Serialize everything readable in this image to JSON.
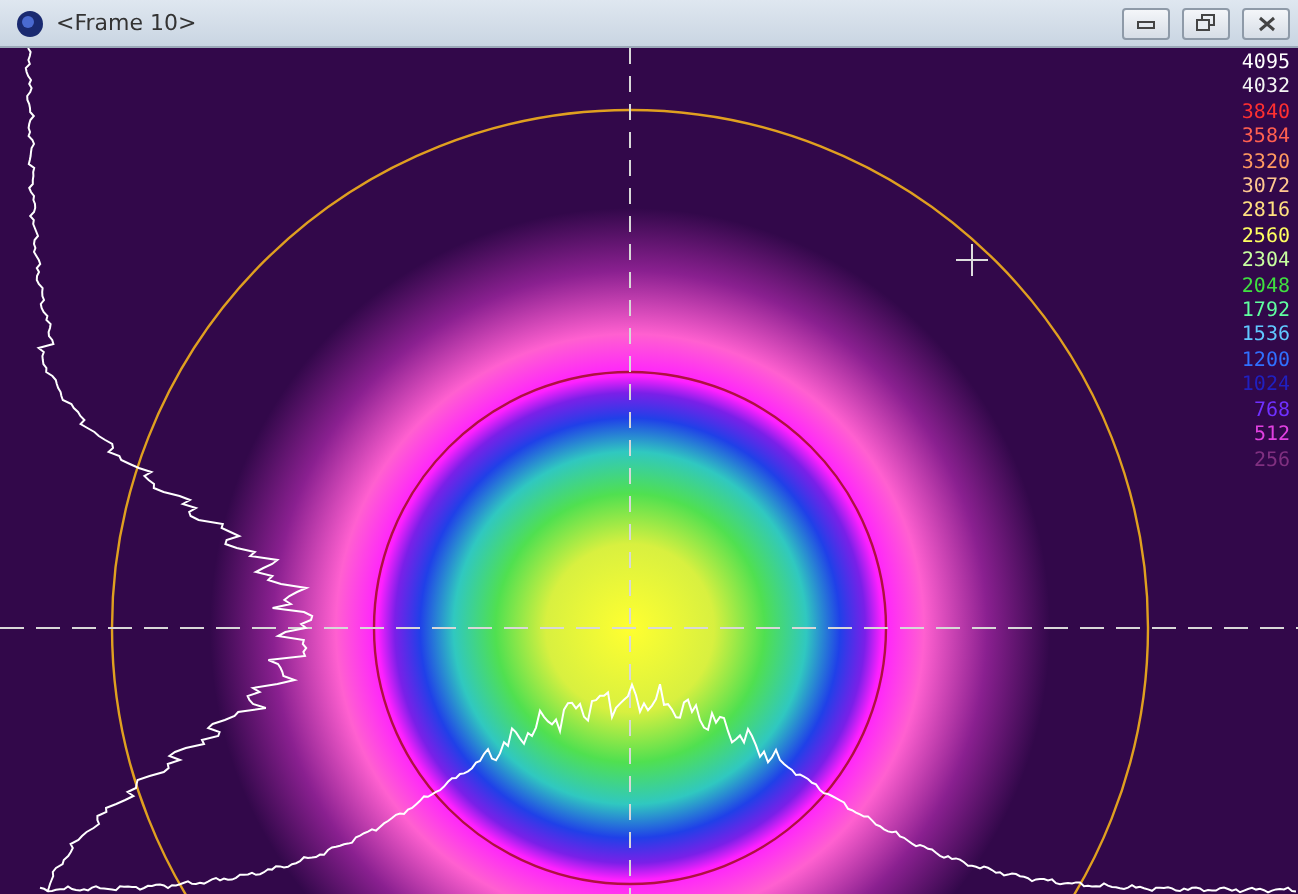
{
  "window": {
    "title": "<Frame 10>"
  },
  "legend": [
    {
      "label": "4095",
      "color": "#ffffff"
    },
    {
      "label": "4032",
      "color": "#f4f4f4"
    },
    {
      "label": "3840",
      "color": "#ff3030"
    },
    {
      "label": "3584",
      "color": "#ff6050"
    },
    {
      "label": "3320",
      "color": "#ff9a60"
    },
    {
      "label": "3072",
      "color": "#ffc890"
    },
    {
      "label": "2816",
      "color": "#ffe080"
    },
    {
      "label": "2560",
      "color": "#ffff60"
    },
    {
      "label": "2304",
      "color": "#c8ffa0"
    },
    {
      "label": "2048",
      "color": "#40e040"
    },
    {
      "label": "1792",
      "color": "#60ffa0"
    },
    {
      "label": "1536",
      "color": "#60c8ff"
    },
    {
      "label": "1200",
      "color": "#3070ff"
    },
    {
      "label": "1024",
      "color": "#2020c0"
    },
    {
      "label": "768",
      "color": "#7030ff"
    },
    {
      "label": "512",
      "color": "#e040e0"
    },
    {
      "label": "256",
      "color": "#803080"
    }
  ]
}
